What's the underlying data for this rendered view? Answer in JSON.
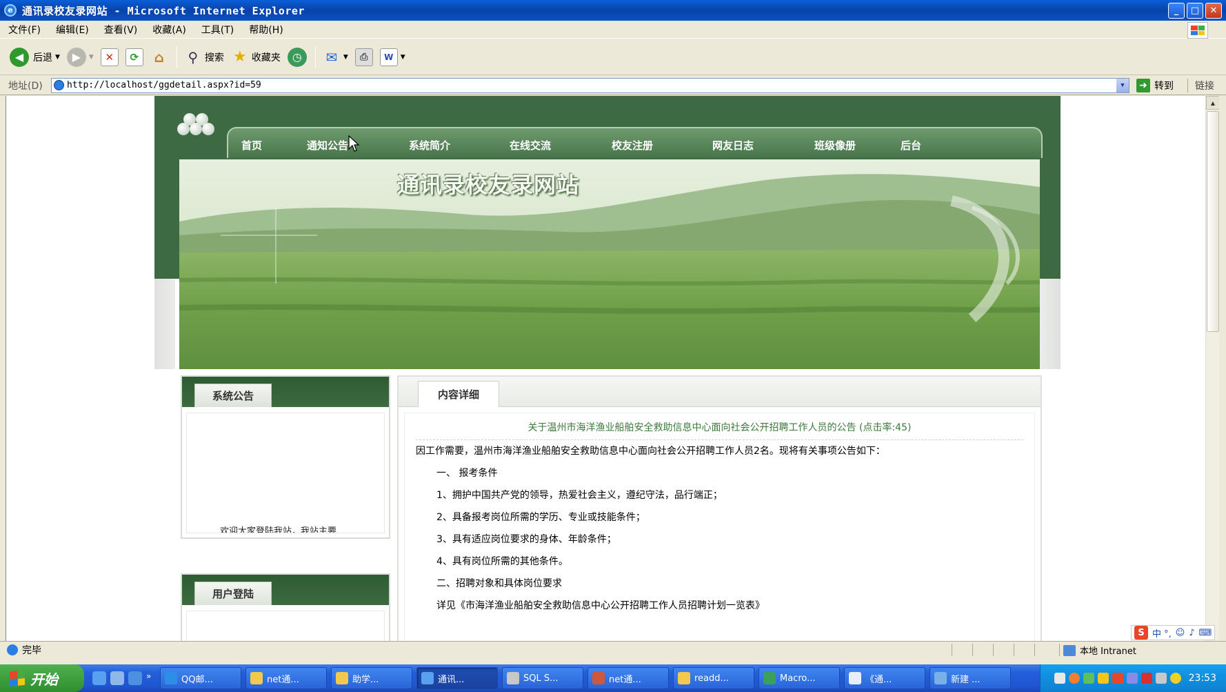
{
  "window": {
    "title": "通讯录校友录网站 - Microsoft Internet Explorer"
  },
  "menubar": {
    "items": [
      "文件(F)",
      "编辑(E)",
      "查看(V)",
      "收藏(A)",
      "工具(T)",
      "帮助(H)"
    ]
  },
  "toolbar": {
    "back_label": "后退",
    "search_label": "搜索",
    "favorites_label": "收藏夹"
  },
  "addressbar": {
    "label": "地址(D)",
    "url": "http://localhost/ggdetail.aspx?id=59",
    "go_label": "转到",
    "links_label": "链接"
  },
  "site": {
    "title": "通讯录校友录网站",
    "nav": [
      "首页",
      "通知公告",
      "系统简介",
      "在线交流",
      "校友注册",
      "网友日志",
      "班级像册",
      "后台"
    ],
    "announcements_tab": "系统公告",
    "announcement_text": "欢迎大家登陆我站，我站主要",
    "login_tab": "用户登陆",
    "content_tab": "内容详细"
  },
  "article": {
    "title": "关于温州市海洋渔业船舶安全救助信息中心面向社会公开招聘工作人员的公告 (点击率:45)",
    "paragraphs": [
      "因工作需要，温州市海洋渔业船舶安全救助信息中心面向社会公开招聘工作人员2名。现将有关事项公告如下：",
      "一、  报考条件",
      "1、拥护中国共产党的领导，热爱社会主义，遵纪守法，品行端正；",
      "2、具备报考岗位所需的学历、专业或技能条件；",
      "3、具有适应岗位要求的身体、年龄条件；",
      "4、具有岗位所需的其他条件。",
      "二、招聘对象和具体岗位要求",
      "详见《市海洋渔业船舶安全救助信息中心公开招聘工作人员招聘计划一览表》"
    ]
  },
  "statusbar": {
    "status": "完毕",
    "zone": "本地 Intranet",
    "ime": "中 °,"
  },
  "taskbar": {
    "start_label": "开始",
    "tasks": [
      "QQ邮...",
      "net通...",
      "助学...",
      "通讯...",
      "SQL S...",
      "net通...",
      "readd...",
      "Macro...",
      "《通...",
      "新建 ..."
    ],
    "clock": "23:53"
  }
}
